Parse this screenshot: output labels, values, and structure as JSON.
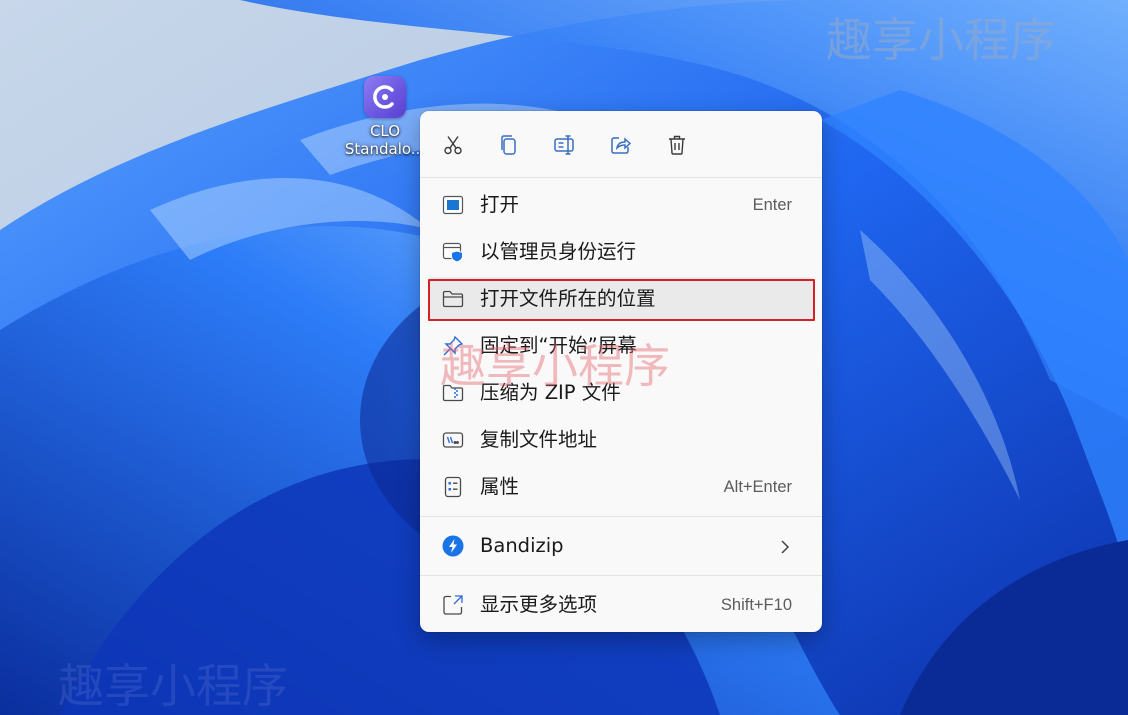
{
  "desktop": {
    "shortcut_label_line1": "CLO",
    "shortcut_label_line2": "Standalo..."
  },
  "context_menu": {
    "quick_actions": [
      {
        "icon": "cut-icon"
      },
      {
        "icon": "copy-icon"
      },
      {
        "icon": "rename-icon"
      },
      {
        "icon": "share-icon"
      },
      {
        "icon": "delete-icon"
      }
    ],
    "items": [
      {
        "icon": "open-icon",
        "label": "打开",
        "shortcut": "Enter"
      },
      {
        "icon": "run-as-admin-icon",
        "label": "以管理员身份运行",
        "shortcut": ""
      },
      {
        "icon": "folder-icon",
        "label": "打开文件所在的位置",
        "shortcut": ""
      },
      {
        "icon": "pin-icon",
        "label": "固定到“开始”屏幕",
        "shortcut": ""
      },
      {
        "icon": "zip-folder-icon",
        "label": "压缩为 ZIP 文件",
        "shortcut": ""
      },
      {
        "icon": "copy-path-icon",
        "label": "复制文件地址",
        "shortcut": ""
      },
      {
        "icon": "properties-icon",
        "label": "属性",
        "shortcut": "Alt+Enter"
      },
      {
        "icon": "bandizip-icon",
        "label": "Bandizip",
        "shortcut": ""
      },
      {
        "icon": "more-options-icon",
        "label": "显示更多选项",
        "shortcut": "Shift+F10"
      }
    ]
  },
  "watermark_text": "趣享小程序",
  "colors": {
    "accent": "#0067c0",
    "highlight_border": "#d52027",
    "menu_background": "#f9f9f9"
  }
}
